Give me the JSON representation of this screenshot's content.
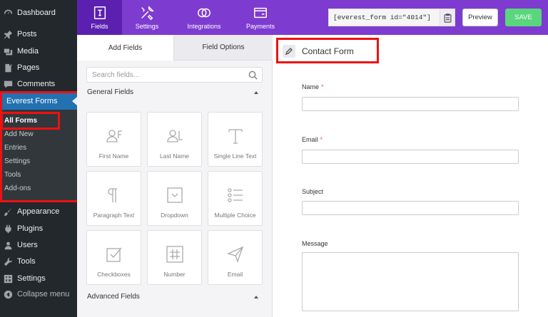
{
  "wp_menu": {
    "dashboard": "Dashboard",
    "posts": "Posts",
    "media": "Media",
    "pages": "Pages",
    "comments": "Comments",
    "everest_forms": "Everest Forms",
    "submenu": [
      "All Forms",
      "Add New",
      "Entries",
      "Settings",
      "Tools",
      "Add-ons"
    ],
    "appearance": "Appearance",
    "plugins": "Plugins",
    "users": "Users",
    "tools": "Tools",
    "settings": "Settings",
    "collapse": "Collapse menu"
  },
  "header": {
    "tabs": [
      "Fields",
      "Settings",
      "Integrations",
      "Payments"
    ],
    "shortcode": "[everest_form id=\"4014\"]",
    "preview_label": "Preview",
    "save_label": "SAVE"
  },
  "fields_panel": {
    "tab_add_fields": "Add Fields",
    "tab_field_options": "Field Options",
    "search_placeholder": "Search fields...",
    "general_title": "General Fields",
    "advanced_title": "Advanced Fields",
    "cards": [
      {
        "label": "First Name",
        "icon": "first-name-icon"
      },
      {
        "label": "Last Name",
        "icon": "last-name-icon"
      },
      {
        "label": "Single Line Text",
        "icon": "text-icon"
      },
      {
        "label": "Paragraph Text",
        "icon": "paragraph-icon"
      },
      {
        "label": "Dropdown",
        "icon": "dropdown-icon"
      },
      {
        "label": "Multiple Choice",
        "icon": "list-icon"
      },
      {
        "label": "Checkboxes",
        "icon": "checkbox-icon"
      },
      {
        "label": "Number",
        "icon": "hash-icon"
      },
      {
        "label": "Email",
        "icon": "send-icon"
      }
    ]
  },
  "form": {
    "title": "Contact Form",
    "fields": [
      {
        "label": "Name",
        "required": "*"
      },
      {
        "label": "Email",
        "required": "*"
      },
      {
        "label": "Subject",
        "required": ""
      },
      {
        "label": "Message",
        "required": ""
      }
    ]
  },
  "colors": {
    "header": "#7e3bd0",
    "active_tab": "#5c20b0",
    "save": "#5ad67d",
    "sidebar": "#23282d",
    "wp_active": "#2271b1",
    "highlight": "#ee1111"
  }
}
